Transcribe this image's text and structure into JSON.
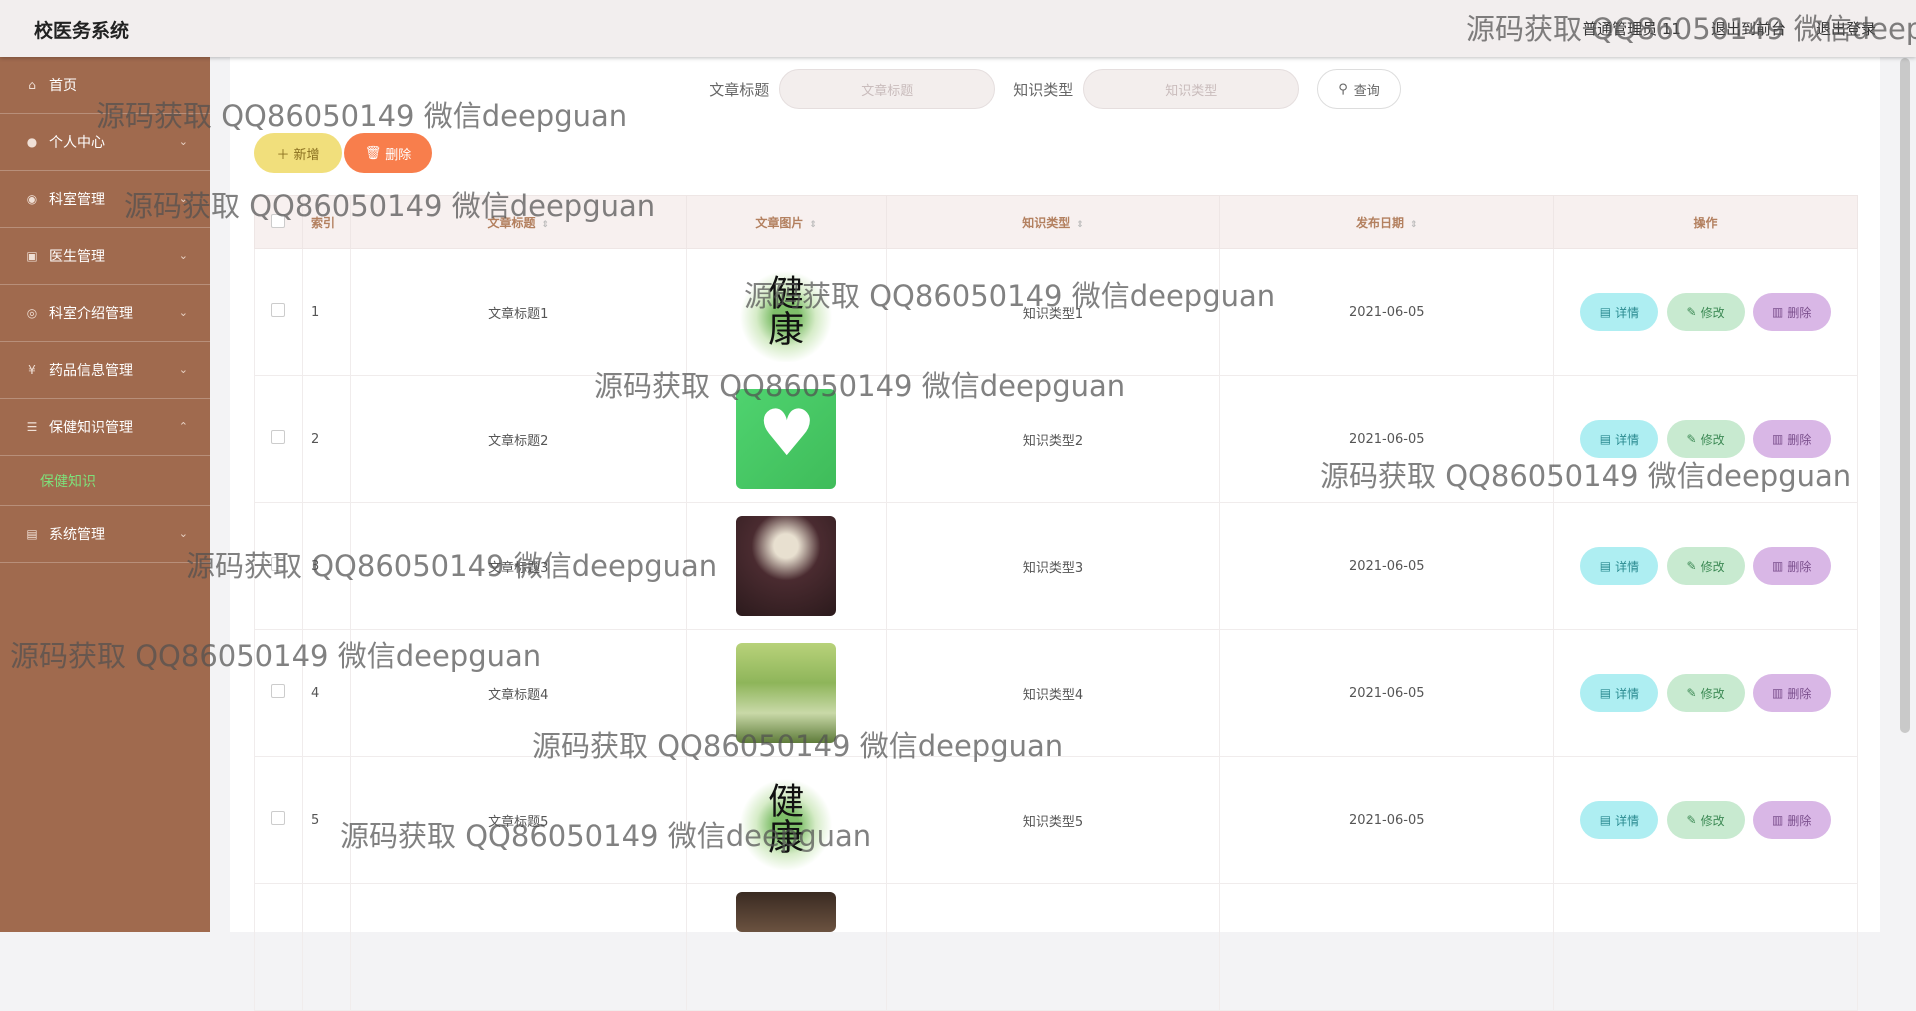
{
  "app": {
    "title": "校医务系统"
  },
  "top_links": [
    "普通管理员 11",
    "退出到前台",
    "退出登录"
  ],
  "sidebar": {
    "items": [
      {
        "label": "首页",
        "icon": "home-icon"
      },
      {
        "label": "个人中心",
        "icon": "user-icon"
      },
      {
        "label": "科室管理",
        "icon": "location-icon"
      },
      {
        "label": "医生管理",
        "icon": "suitcase-icon"
      },
      {
        "label": "科室介绍管理",
        "icon": "compass-icon"
      },
      {
        "label": "药品信息管理",
        "icon": "money-icon"
      },
      {
        "label": "保健知识管理",
        "icon": "menu-icon"
      },
      {
        "label": "系统管理",
        "icon": "goods-icon"
      }
    ],
    "active_sub": "保健知识"
  },
  "search": {
    "title_label": "文章标题",
    "title_placeholder": "文章标题",
    "type_label": "知识类型",
    "type_placeholder": "知识类型",
    "query_label": "查询"
  },
  "actions": {
    "add_label": "新增",
    "delete_label": "删除"
  },
  "table": {
    "headers": {
      "index": "索引",
      "title": "文章标题",
      "image": "文章图片",
      "type": "知识类型",
      "date": "发布日期",
      "ops": "操作"
    },
    "rows": [
      {
        "index": "1",
        "title": "文章标题1",
        "image": "calligraphy",
        "type": "知识类型1",
        "date": "2021-06-05"
      },
      {
        "index": "2",
        "title": "文章标题2",
        "image": "heart-app",
        "type": "知识类型2",
        "date": "2021-06-05"
      },
      {
        "index": "3",
        "title": "文章标题3",
        "image": "tea",
        "type": "知识类型3",
        "date": "2021-06-05"
      },
      {
        "index": "4",
        "title": "文章标题4",
        "image": "elderly",
        "type": "知识类型4",
        "date": "2021-06-05"
      },
      {
        "index": "5",
        "title": "文章标题5",
        "image": "calligraphy",
        "type": "知识类型5",
        "date": "2021-06-05"
      }
    ],
    "op_labels": {
      "detail": "详情",
      "edit": "修改",
      "delete": "删除"
    }
  },
  "watermark": "源码获取 QQ86050149 微信deepguan",
  "colors": {
    "sidebar": "#a06a4e",
    "active_sub": "#7ee07a",
    "add": "#f1df7c",
    "delete": "#f87e4c"
  }
}
